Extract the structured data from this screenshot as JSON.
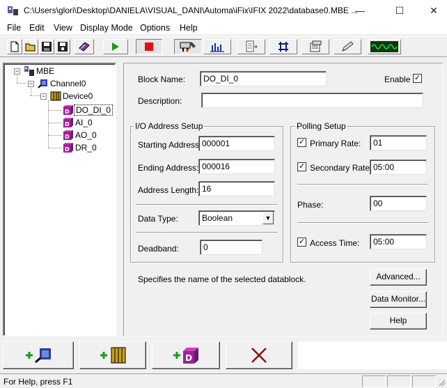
{
  "window": {
    "title": "C:\\Users\\glori\\Desktop\\DANIELA\\VISUAL_DANI\\Automa\\iFix\\IFIX 2022\\database0.MBE ...",
    "minimize_glyph": "—",
    "maximize_glyph": "☐",
    "close_glyph": "✕"
  },
  "menu": [
    "File",
    "Edit",
    "View",
    "Display Mode",
    "Options",
    "Help"
  ],
  "toolbar": {
    "buttons": [
      "new-file-icon",
      "open-folder-icon",
      "save-icon",
      "save-all-icon",
      "book-icon",
      "start-play-icon",
      "stop-icon",
      "tools-config-icon",
      "bar-chart-icon",
      "export-icon",
      "network-icon",
      "properties-icon",
      "pen-edit-icon",
      "waveform-monitor-icon"
    ],
    "colors": {
      "play": "#1a9b1a",
      "stop": "#e01010",
      "monitor_bg": "#0a3a10",
      "monitor_wave": "#33dd33"
    }
  },
  "tree": {
    "root": {
      "label": "MBE",
      "expander": "−"
    },
    "channel": {
      "label": "Channel0",
      "expander": "−"
    },
    "device": {
      "label": "Device0",
      "expander": "−"
    },
    "blocks": [
      {
        "label": "DO_DI_0",
        "selected": true
      },
      {
        "label": "AI_0",
        "selected": false
      },
      {
        "label": "AO_0",
        "selected": false
      },
      {
        "label": "DR_0",
        "selected": false
      }
    ]
  },
  "form": {
    "block_name_label": "Block Name:",
    "block_name_value": "DO_DI_0",
    "enable_label": "Enable",
    "enable_checked": true,
    "description_label": "Description:",
    "description_value": "",
    "io_group_title": "I/O Address Setup",
    "starting_address_label": "Starting Address:",
    "starting_address_value": "000001",
    "ending_address_label": "Ending Address:",
    "ending_address_value": "000016",
    "address_length_label": "Address Length:",
    "address_length_value": "16",
    "data_type_label": "Data Type:",
    "data_type_value": "Boolean",
    "deadband_label": "Deadband:",
    "deadband_value": "0",
    "polling_group_title": "Polling Setup",
    "primary_rate_label": "Primary Rate:",
    "primary_rate_value": "01",
    "primary_rate_checked": true,
    "secondary_rate_label": "Secondary Rate:",
    "secondary_rate_value": "05:00",
    "secondary_rate_checked": true,
    "phase_label": "Phase:",
    "phase_value": "00",
    "access_time_label": "Access Time:",
    "access_time_value": "05:00",
    "access_time_checked": true,
    "hint_text": "Specifies the name of the selected datablock.",
    "advanced_button": "Advanced...",
    "data_monitor_button": "Data Monitor...",
    "help_button": "Help",
    "check_glyph": "✓",
    "dropdown_glyph": "▼"
  },
  "bottom_buttons": [
    "add-channel-icon",
    "add-device-icon",
    "add-datablock-icon",
    "delete-icon"
  ],
  "status": {
    "text": "For Help, press F1"
  }
}
